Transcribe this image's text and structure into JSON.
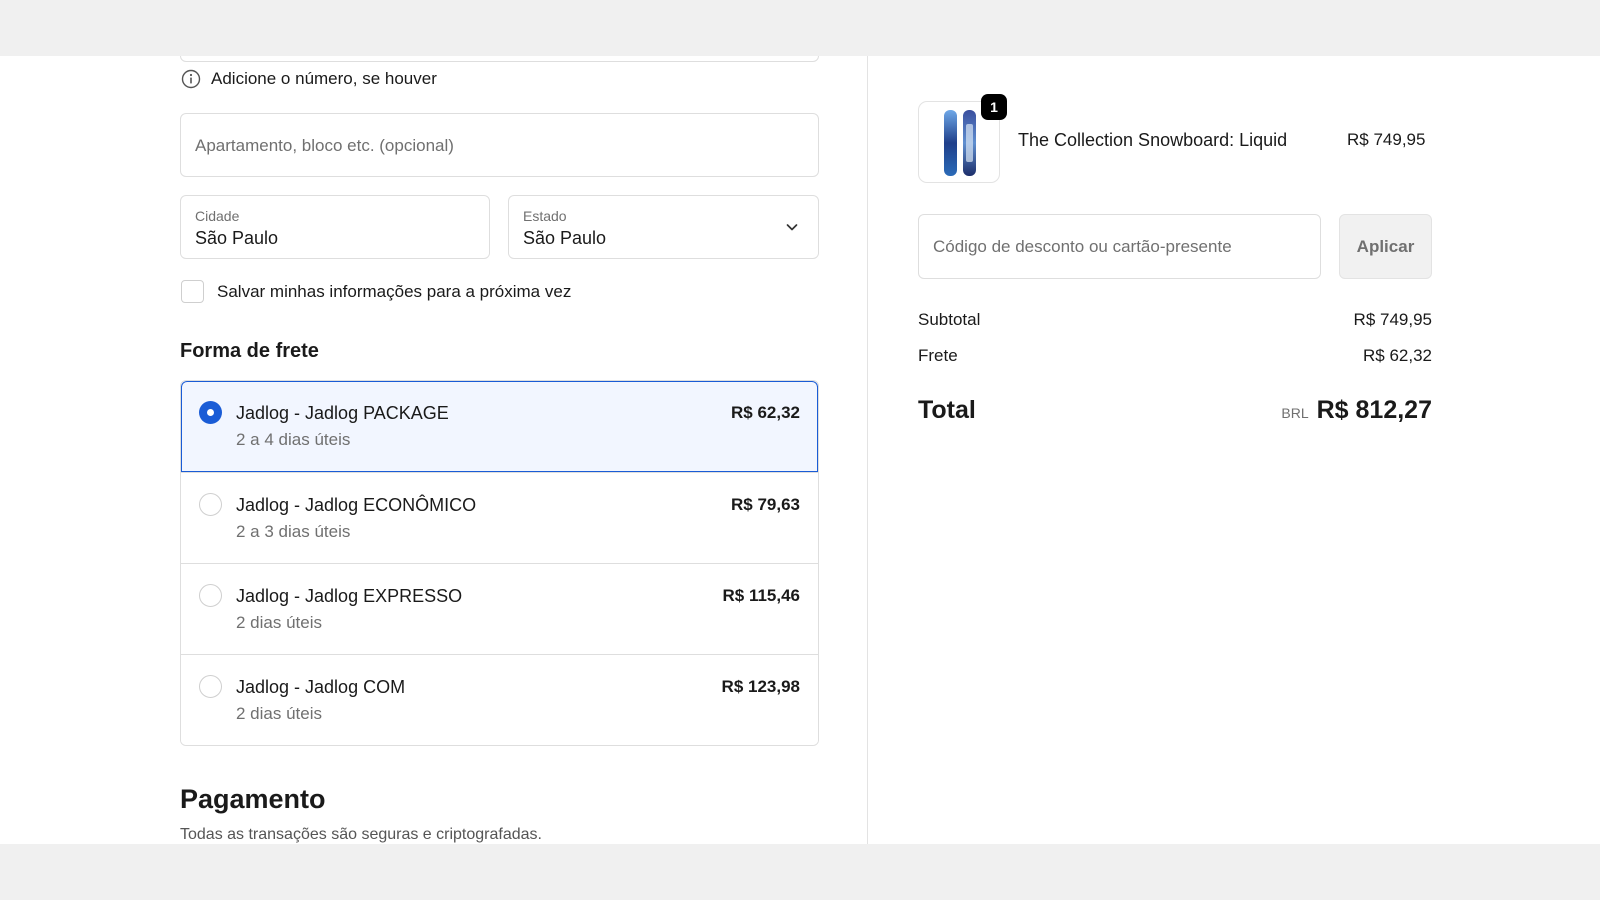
{
  "address": {
    "number_hint": "Adicione o número, se houver",
    "apartment_placeholder": "Apartamento, bloco etc. (opcional)",
    "city_label": "Cidade",
    "city_value": "São Paulo",
    "state_label": "Estado",
    "state_value": "São Paulo",
    "save_info_label": "Salvar minhas informações para a próxima vez"
  },
  "shipping": {
    "title": "Forma de frete",
    "options": [
      {
        "name": "Jadlog - Jadlog PACKAGE",
        "days": "2 a 4 dias úteis",
        "price": "R$ 62,32",
        "selected": true
      },
      {
        "name": "Jadlog - Jadlog ECONÔMICO",
        "days": "2 a 3 dias úteis",
        "price": "R$ 79,63",
        "selected": false
      },
      {
        "name": "Jadlog - Jadlog EXPRESSO",
        "days": "2 dias úteis",
        "price": "R$ 115,46",
        "selected": false
      },
      {
        "name": "Jadlog - Jadlog COM",
        "days": "2 dias úteis",
        "price": "R$ 123,98",
        "selected": false
      }
    ]
  },
  "payment": {
    "title": "Pagamento",
    "subtitle": "Todas as transações são seguras e criptografadas."
  },
  "summary": {
    "product": {
      "quantity": "1",
      "name": "The Collection Snowboard: Liquid",
      "price": "R$ 749,95"
    },
    "discount_placeholder": "Código de desconto ou cartão-presente",
    "apply_label": "Aplicar",
    "subtotal_label": "Subtotal",
    "subtotal_value": "R$ 749,95",
    "shipping_label": "Frete",
    "shipping_value": "R$ 62,32",
    "total_label": "Total",
    "currency": "BRL",
    "total_value": "R$ 812,27"
  },
  "colors": {
    "accent": "#1a5cd6",
    "selected_bg": "#f2f6ff",
    "page_bg": "#f0f0f0"
  }
}
